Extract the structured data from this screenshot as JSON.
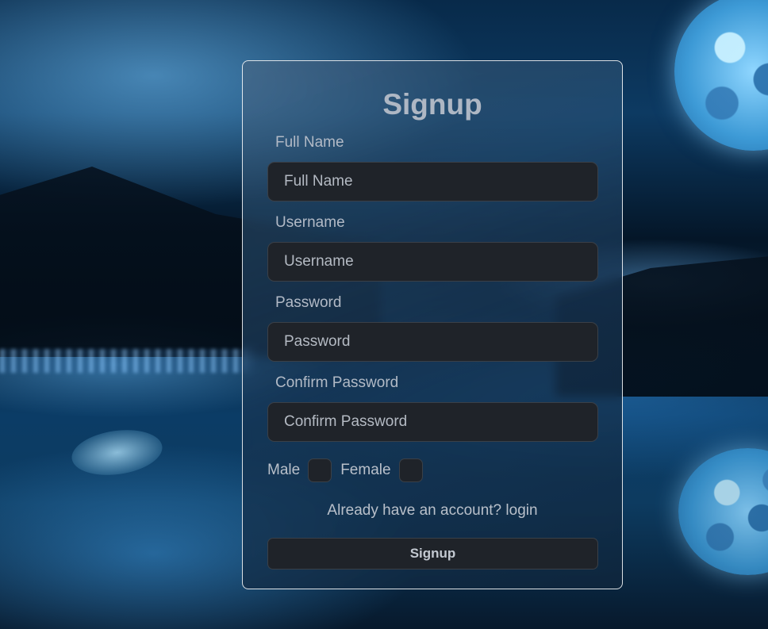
{
  "form": {
    "title": "Signup",
    "full_name": {
      "label": "Full Name",
      "placeholder": "Full Name",
      "value": ""
    },
    "username": {
      "label": "Username",
      "placeholder": "Username",
      "value": ""
    },
    "password": {
      "label": "Password",
      "placeholder": "Password",
      "value": ""
    },
    "confirm_password": {
      "label": "Confirm Password",
      "placeholder": "Confirm Password",
      "value": ""
    },
    "gender": {
      "male_label": "Male",
      "female_label": "Female",
      "male_checked": false,
      "female_checked": false
    },
    "login_prompt": "Already have an account?",
    "login_link": "login",
    "submit_label": "Signup"
  },
  "colors": {
    "input_bg": "#1f2329",
    "text": "#b9c0ca",
    "card_border": "#ffffff"
  }
}
